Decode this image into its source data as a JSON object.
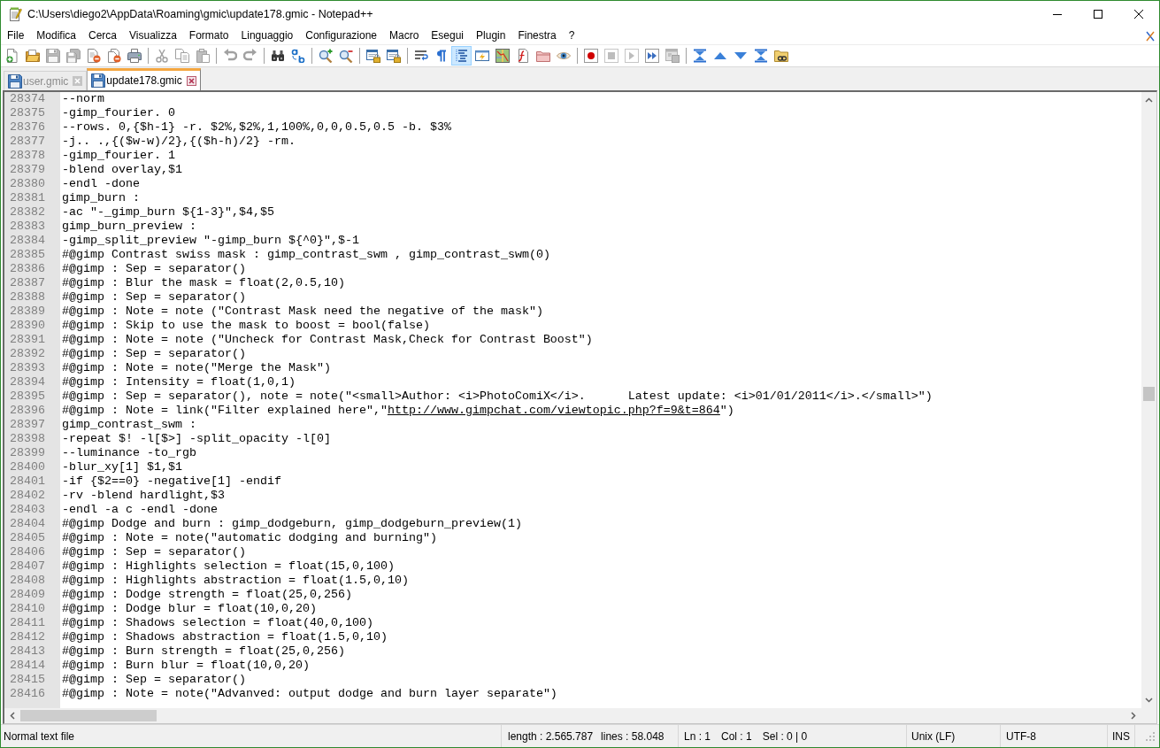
{
  "window": {
    "title": "C:\\Users\\diego2\\AppData\\Roaming\\gmic\\update178.gmic - Notepad++"
  },
  "menu_bar": {
    "items": [
      "File",
      "Modifica",
      "Cerca",
      "Visualizza",
      "Formato",
      "Linguaggio",
      "Configurazione",
      "Macro",
      "Esegui",
      "Plugin",
      "Finestra",
      "?"
    ]
  },
  "toolbar": {
    "groups": [
      [
        {
          "kind": "new",
          "disabled": false,
          "pressed": false
        },
        {
          "kind": "open",
          "disabled": false,
          "pressed": false
        },
        {
          "kind": "save",
          "disabled": true,
          "pressed": false
        },
        {
          "kind": "saveall",
          "disabled": true,
          "pressed": false
        },
        {
          "kind": "close",
          "disabled": false,
          "pressed": false
        },
        {
          "kind": "closeall",
          "disabled": false,
          "pressed": false
        },
        {
          "kind": "print",
          "disabled": false,
          "pressed": false
        }
      ],
      [
        {
          "kind": "cut",
          "disabled": true,
          "pressed": false
        },
        {
          "kind": "copy",
          "disabled": true,
          "pressed": false
        },
        {
          "kind": "paste",
          "disabled": true,
          "pressed": false
        }
      ],
      [
        {
          "kind": "undo",
          "disabled": true,
          "pressed": false
        },
        {
          "kind": "redo",
          "disabled": true,
          "pressed": false
        }
      ],
      [
        {
          "kind": "find",
          "disabled": false,
          "pressed": false
        },
        {
          "kind": "replace",
          "disabled": false,
          "pressed": false
        }
      ],
      [
        {
          "kind": "zoomin",
          "disabled": false,
          "pressed": false
        },
        {
          "kind": "zoomout",
          "disabled": false,
          "pressed": false
        }
      ],
      [
        {
          "kind": "syncv",
          "disabled": false,
          "pressed": false
        },
        {
          "kind": "synch",
          "disabled": false,
          "pressed": false
        }
      ],
      [
        {
          "kind": "wrap",
          "disabled": false,
          "pressed": false
        },
        {
          "kind": "allchars",
          "disabled": false,
          "pressed": false
        },
        {
          "kind": "indent",
          "disabled": false,
          "pressed": true
        },
        {
          "kind": "udl",
          "disabled": false,
          "pressed": false
        },
        {
          "kind": "map",
          "disabled": false,
          "pressed": false
        },
        {
          "kind": "functions",
          "disabled": false,
          "pressed": false
        },
        {
          "kind": "workspace",
          "disabled": false,
          "pressed": false
        },
        {
          "kind": "monitor",
          "disabled": false,
          "pressed": false
        }
      ],
      [
        {
          "kind": "record",
          "disabled": false,
          "pressed": false
        },
        {
          "kind": "stop",
          "disabled": true,
          "pressed": false
        },
        {
          "kind": "play",
          "disabled": true,
          "pressed": false
        },
        {
          "kind": "playmulti",
          "disabled": false,
          "pressed": false
        },
        {
          "kind": "savemacro",
          "disabled": true,
          "pressed": false
        }
      ],
      [
        {
          "kind": "top",
          "disabled": false,
          "pressed": false
        },
        {
          "kind": "up",
          "disabled": false,
          "pressed": false
        },
        {
          "kind": "down",
          "disabled": false,
          "pressed": false
        },
        {
          "kind": "bottom",
          "disabled": false,
          "pressed": false
        },
        {
          "kind": "link",
          "disabled": false,
          "pressed": false
        }
      ]
    ]
  },
  "tabs": [
    {
      "label": "user.gmic",
      "selected": false
    },
    {
      "label": "update178.gmic",
      "selected": true
    }
  ],
  "editor": {
    "lines": [
      {
        "number": "28374",
        "text": "--norm"
      },
      {
        "number": "28375",
        "text": "-gimp_fourier. 0"
      },
      {
        "number": "28376",
        "text": "--rows. 0,{$h-1} -r. $2%,$2%,1,100%,0,0,0.5,0.5 -b. $3%"
      },
      {
        "number": "28377",
        "text": "-j.. .,{($w-w)/2},{($h-h)/2} -rm."
      },
      {
        "number": "28378",
        "text": "-gimp_fourier. 1"
      },
      {
        "number": "28379",
        "text": "-blend overlay,$1"
      },
      {
        "number": "28380",
        "text": "-endl -done"
      },
      {
        "number": "28381",
        "text": "gimp_burn :"
      },
      {
        "number": "28382",
        "text": "-ac \"-_gimp_burn ${1-3}\",$4,$5"
      },
      {
        "number": "28383",
        "text": "gimp_burn_preview :"
      },
      {
        "number": "28384",
        "text": "-gimp_split_preview \"-gimp_burn ${^0}\",$-1"
      },
      {
        "number": "28385",
        "text": "#@gimp Contrast swiss mask : gimp_contrast_swm , gimp_contrast_swm(0)"
      },
      {
        "number": "28386",
        "text": "#@gimp : Sep = separator()"
      },
      {
        "number": "28387",
        "text": "#@gimp : Blur the mask = float(2,0.5,10)"
      },
      {
        "number": "28388",
        "text": "#@gimp : Sep = separator()"
      },
      {
        "number": "28389",
        "text": "#@gimp : Note = note (\"Contrast Mask need the negative of the mask\")"
      },
      {
        "number": "28390",
        "text": "#@gimp : Skip to use the mask to boost = bool(false)"
      },
      {
        "number": "28391",
        "text": "#@gimp : Note = note (\"Uncheck for Contrast Mask,Check for Contrast Boost\")"
      },
      {
        "number": "28392",
        "text": "#@gimp : Sep = separator()"
      },
      {
        "number": "28393",
        "text": "#@gimp : Note = note(\"Merge the Mask\")"
      },
      {
        "number": "28394",
        "text": "#@gimp : Intensity = float(1,0,1)"
      },
      {
        "number": "28395",
        "text": "#@gimp : Sep = separator(), note = note(\"<small>Author: <i>PhotoComiX</i>.      Latest update: <i>01/01/2011</i>.</small>\")"
      },
      {
        "number": "28396",
        "text": "#@gimp : Note = link(\"Filter explained here\",\"",
        "link": "http://www.gimpchat.com/viewtopic.php?f=9&t=864",
        "text_after": "\")"
      },
      {
        "number": "28397",
        "text": "gimp_contrast_swm :"
      },
      {
        "number": "28398",
        "text": "-repeat $! -l[$>] -split_opacity -l[0]"
      },
      {
        "number": "28399",
        "text": "--luminance -to_rgb"
      },
      {
        "number": "28400",
        "text": "-blur_xy[1] $1,$1"
      },
      {
        "number": "28401",
        "text": "-if {$2==0} -negative[1] -endif"
      },
      {
        "number": "28402",
        "text": "-rv -blend hardlight,$3"
      },
      {
        "number": "28403",
        "text": "-endl -a c -endl -done"
      },
      {
        "number": "28404",
        "text": "#@gimp Dodge and burn : gimp_dodgeburn, gimp_dodgeburn_preview(1)"
      },
      {
        "number": "28405",
        "text": "#@gimp : Note = note(\"automatic dodging and burning\")"
      },
      {
        "number": "28406",
        "text": "#@gimp : Sep = separator()"
      },
      {
        "number": "28407",
        "text": "#@gimp : Highlights selection = float(15,0,100)"
      },
      {
        "number": "28408",
        "text": "#@gimp : Highlights abstraction = float(1.5,0,10)"
      },
      {
        "number": "28409",
        "text": "#@gimp : Dodge strength = float(25,0,256)"
      },
      {
        "number": "28410",
        "text": "#@gimp : Dodge blur = float(10,0,20)"
      },
      {
        "number": "28411",
        "text": "#@gimp : Shadows selection = float(40,0,100)"
      },
      {
        "number": "28412",
        "text": "#@gimp : Shadows abstraction = float(1.5,0,10)"
      },
      {
        "number": "28413",
        "text": "#@gimp : Burn strength = float(25,0,256)"
      },
      {
        "number": "28414",
        "text": "#@gimp : Burn blur = float(10,0,20)"
      },
      {
        "number": "28415",
        "text": "#@gimp : Sep = separator()"
      },
      {
        "number": "28416",
        "text": "#@gimp : Note = note(\"Advanved: output dodge and burn layer separate\")"
      }
    ]
  },
  "status_bar": {
    "file_type": "Normal text file",
    "length": "length : 2.565.787",
    "lines": "lines : 58.048",
    "line": "Ln : 1",
    "column": "Col : 1",
    "selection": "Sel : 0 | 0",
    "eol": "Unix (LF)",
    "encoding": "UTF-8",
    "mode": "INS"
  }
}
